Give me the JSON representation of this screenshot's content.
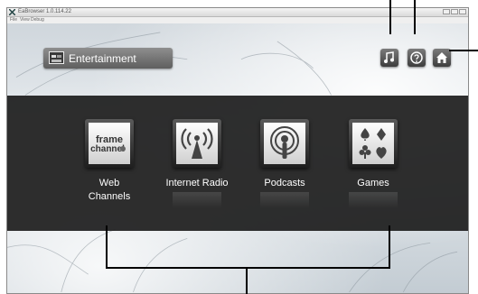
{
  "window": {
    "title": "EaBrowser 1.0.114.22",
    "menu": [
      "File",
      "View",
      "Debug"
    ]
  },
  "header": {
    "section_title": "Entertainment"
  },
  "top_buttons": [
    {
      "name": "music",
      "icon": "music-note-icon"
    },
    {
      "name": "help",
      "icon": "help-icon"
    },
    {
      "name": "home",
      "icon": "home-icon"
    }
  ],
  "tiles": [
    {
      "label_line1": "Web",
      "label_line2": "Channels",
      "icon": "framechannel-logo-icon",
      "logo_text_1": "frame",
      "logo_text_2": "channel"
    },
    {
      "label_line1": "Internet Radio",
      "label_line2": "",
      "icon": "radio-tower-icon"
    },
    {
      "label_line1": "Podcasts",
      "label_line2": "",
      "icon": "podcast-icon"
    },
    {
      "label_line1": "Games",
      "label_line2": "",
      "icon": "card-suits-icon"
    }
  ],
  "colors": {
    "band": "#1c1c1c",
    "button": "#5a5a5a",
    "callout": "#000000"
  }
}
